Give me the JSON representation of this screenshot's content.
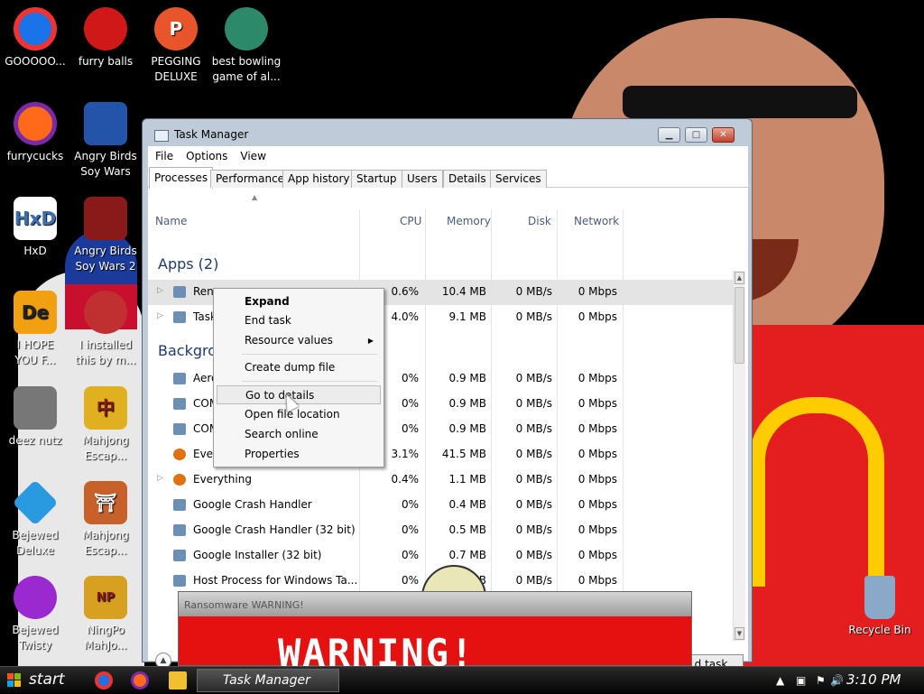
{
  "desktop": {
    "icons": [
      {
        "label": "GOOOOO...",
        "icon": "chrome-icon",
        "color": "#1a73e8"
      },
      {
        "label": "furry balls",
        "icon": "furry-ball-icon",
        "color": "#d01818"
      },
      {
        "label": "PEGGING\nDELUXE",
        "icon": "peggle-icon",
        "color": "#e8552a"
      },
      {
        "label": "best bowling\ngame of al...",
        "icon": "bowling-game-icon",
        "color": "#2c8a6a"
      },
      {
        "label": "furrycucks",
        "icon": "firefox-icon",
        "color": "#ff6a1a"
      },
      {
        "label": "Angry Birds\nSoy Wars",
        "icon": "angry-birds-icon",
        "color": "#2255aa"
      },
      {
        "label": "HxD",
        "icon": "hxd-icon",
        "color": "#3a6fb0"
      },
      {
        "label": "Angry Birds\nSoy Wars 2",
        "icon": "angry-birds-2-icon",
        "color": "#8a1a1a"
      },
      {
        "label": "I HOPE\nYOU F...",
        "icon": "de-icon",
        "color": "#f0a010"
      },
      {
        "label": "I installed\nthis by m...",
        "icon": "cartoon-icon",
        "color": "#c03030"
      },
      {
        "label": "deez nutz",
        "icon": "windows-stack-icon",
        "color": "#777777"
      },
      {
        "label": "Mahjong\nEscap...",
        "icon": "mahjong-icon",
        "color": "#e0b020"
      },
      {
        "label": "Bejewed\nDeluxe",
        "icon": "gem-icon",
        "color": "#2a9ae0"
      },
      {
        "label": "Mahjong\nEscap...",
        "icon": "torii-icon",
        "color": "#c8602a"
      },
      {
        "label": "Bejewed\nTwisty",
        "icon": "twisty-gem-icon",
        "color": "#9a2ad0"
      },
      {
        "label": "NingPo\nMahJo...",
        "icon": "ningpo-icon",
        "color": "#d8a020"
      },
      {
        "label": "Recycle Bin",
        "icon": "recycle-bin-icon",
        "color": "#8aa8c8"
      }
    ]
  },
  "task_manager": {
    "title": "Task Manager",
    "menu": [
      "File",
      "Options",
      "View"
    ],
    "tabs": [
      "Processes",
      "Performance",
      "App history",
      "Startup",
      "Users",
      "Details",
      "Services"
    ],
    "active_tab": "Processes",
    "columns": {
      "name": "Name",
      "cpu": "CPU",
      "memory": "Memory",
      "disk": "Disk",
      "network": "Network"
    },
    "groups": {
      "apps": "Apps (2)",
      "background": "Backgrou"
    },
    "rows": [
      {
        "name": "Rens",
        "cpu": "0.6%",
        "memory": "10.4 MB",
        "disk": "0 MB/s",
        "network": "0 Mbps"
      },
      {
        "name": "Task",
        "cpu": "4.0%",
        "memory": "9.1 MB",
        "disk": "0 MB/s",
        "network": "0 Mbps"
      },
      {
        "name": "Aero",
        "cpu": "0%",
        "memory": "0.9 MB",
        "disk": "0 MB/s",
        "network": "0 Mbps"
      },
      {
        "name": "COM",
        "cpu": "0%",
        "memory": "0.9 MB",
        "disk": "0 MB/s",
        "network": "0 Mbps"
      },
      {
        "name": "COM",
        "cpu": "0%",
        "memory": "0.9 MB",
        "disk": "0 MB/s",
        "network": "0 Mbps"
      },
      {
        "name": "Ever",
        "cpu": "3.1%",
        "memory": "41.5 MB",
        "disk": "0 MB/s",
        "network": "0 Mbps"
      },
      {
        "name": "Everything",
        "cpu": "0.4%",
        "memory": "1.1 MB",
        "disk": "0 MB/s",
        "network": "0 Mbps"
      },
      {
        "name": "Google Crash Handler",
        "cpu": "0%",
        "memory": "0.4 MB",
        "disk": "0 MB/s",
        "network": "0 Mbps"
      },
      {
        "name": "Google Crash Handler (32 bit)",
        "cpu": "0%",
        "memory": "0.5 MB",
        "disk": "0 MB/s",
        "network": "0 Mbps"
      },
      {
        "name": "Google Installer (32 bit)",
        "cpu": "0%",
        "memory": "0.7 MB",
        "disk": "0 MB/s",
        "network": "0 Mbps"
      },
      {
        "name": "Host Process for Windows Ta...",
        "cpu": "0%",
        "memory": "MB",
        "disk": "0 MB/s",
        "network": "0 Mbps"
      }
    ],
    "end_task": "d task"
  },
  "context_menu": {
    "items": [
      "Expand",
      "End task",
      "Resource values",
      "Create dump file",
      "Go to details",
      "Open file location",
      "Search online",
      "Properties"
    ]
  },
  "warning_window": {
    "title": "Ransomware WARNING!",
    "message": "WARNING!"
  },
  "taskbar": {
    "start_label": "start",
    "active_task": "Task Manager",
    "clock": "3:10 PM"
  }
}
